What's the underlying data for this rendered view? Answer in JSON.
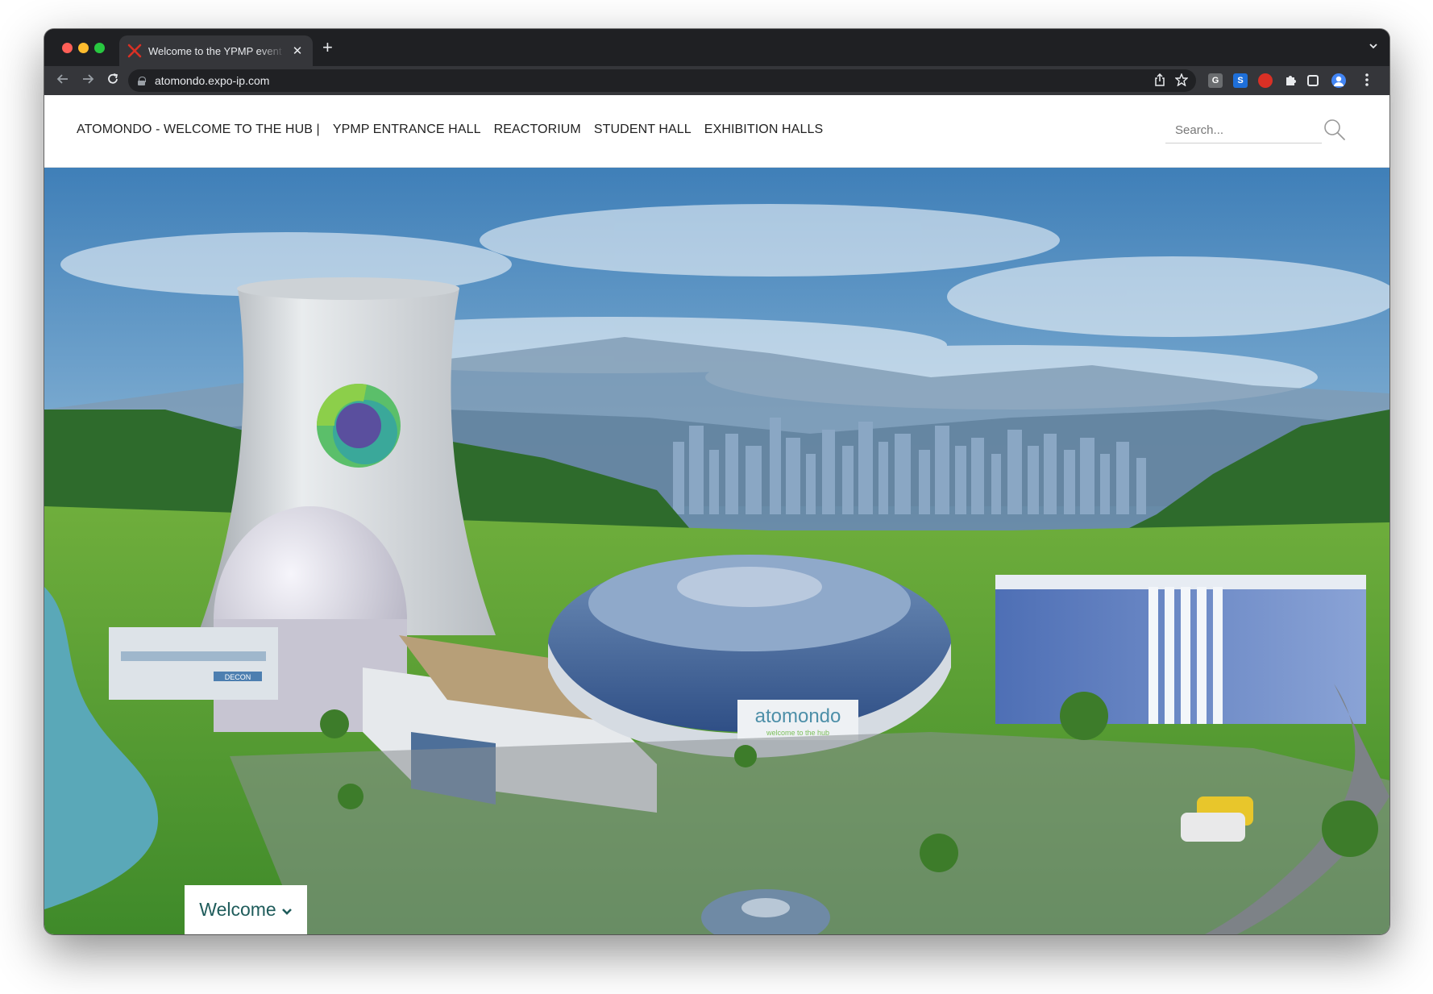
{
  "browser": {
    "tab_title": "Welcome to the YPMP event on atomondo",
    "url": "atomondo.expo-ip.com",
    "new_tab_symbol": "+",
    "tab_close_symbol": "✕",
    "extensions": {
      "g": "G",
      "s": "S",
      "r": "●"
    }
  },
  "site": {
    "nav": [
      {
        "label": "ATOMONDO - WELCOME TO THE HUB |"
      },
      {
        "label": "YPMP ENTRANCE HALL"
      },
      {
        "label": "REACTORIUM"
      },
      {
        "label": "STUDENT HALL"
      },
      {
        "label": "EXHIBITION HALLS"
      }
    ],
    "search_placeholder": "Search..."
  },
  "hero": {
    "arena_sign": "atomondo",
    "arena_tagline": "welcome to the hub",
    "building_sign": "DECON",
    "welcome_label": "Welcome",
    "colors": {
      "sky_top": "#3f7fb8",
      "sky_bottom": "#d9e7ef",
      "accent": "#1f5c5b"
    }
  }
}
